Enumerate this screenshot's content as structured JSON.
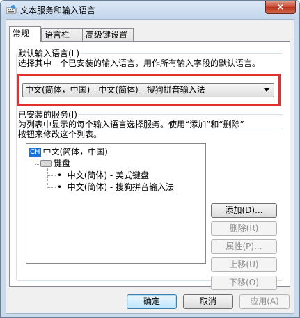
{
  "window": {
    "title": "文本服务和输入语言",
    "close_label": "×"
  },
  "tabs": [
    {
      "label": "常规",
      "active": true
    },
    {
      "label": "语言栏",
      "active": false
    },
    {
      "label": "高级键设置",
      "active": false
    }
  ],
  "default_language": {
    "group_label": "默认输入语言(L)",
    "description": "选择其中一个已安装的输入语言，用作所有输入字段的默认语言。",
    "selected_value": "中文(简体，中国) - 中文(简体) - 搜狗拼音输入法"
  },
  "installed_services": {
    "group_label": "已安装的服务(I)",
    "description_line1": "为列表中显示的每个输入语言选择服务。使用“添加”和“删除”",
    "description_line2": "按钮来修改这个列表。",
    "tree": {
      "language_badge": "CH",
      "language_label": "中文(简体，中国)",
      "category_label": "键盘",
      "items": [
        "中文(简体) - 美式键盘",
        "中文(简体) - 搜狗拼音输入法"
      ]
    },
    "buttons": {
      "add": "添加(D)...",
      "remove": "删除(R)",
      "properties": "属性(P)...",
      "move_up": "上移(U)",
      "move_down": "下移(O)"
    }
  },
  "footer": {
    "ok": "确定",
    "cancel": "取消",
    "apply": "应用(A)"
  },
  "colors": {
    "highlight": "#e03030",
    "badge": "#1a73d9"
  }
}
